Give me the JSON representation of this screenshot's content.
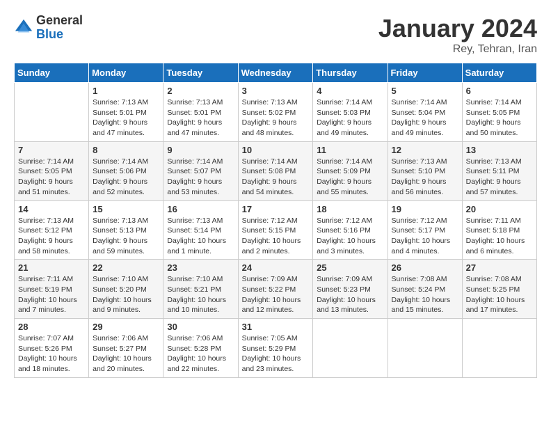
{
  "logo": {
    "general": "General",
    "blue": "Blue"
  },
  "title": "January 2024",
  "location": "Rey, Tehran, Iran",
  "days_of_week": [
    "Sunday",
    "Monday",
    "Tuesday",
    "Wednesday",
    "Thursday",
    "Friday",
    "Saturday"
  ],
  "weeks": [
    [
      {
        "day": "",
        "info": ""
      },
      {
        "day": "1",
        "info": "Sunrise: 7:13 AM\nSunset: 5:01 PM\nDaylight: 9 hours\nand 47 minutes."
      },
      {
        "day": "2",
        "info": "Sunrise: 7:13 AM\nSunset: 5:01 PM\nDaylight: 9 hours\nand 47 minutes."
      },
      {
        "day": "3",
        "info": "Sunrise: 7:13 AM\nSunset: 5:02 PM\nDaylight: 9 hours\nand 48 minutes."
      },
      {
        "day": "4",
        "info": "Sunrise: 7:14 AM\nSunset: 5:03 PM\nDaylight: 9 hours\nand 49 minutes."
      },
      {
        "day": "5",
        "info": "Sunrise: 7:14 AM\nSunset: 5:04 PM\nDaylight: 9 hours\nand 49 minutes."
      },
      {
        "day": "6",
        "info": "Sunrise: 7:14 AM\nSunset: 5:05 PM\nDaylight: 9 hours\nand 50 minutes."
      }
    ],
    [
      {
        "day": "7",
        "info": "Sunrise: 7:14 AM\nSunset: 5:05 PM\nDaylight: 9 hours\nand 51 minutes."
      },
      {
        "day": "8",
        "info": "Sunrise: 7:14 AM\nSunset: 5:06 PM\nDaylight: 9 hours\nand 52 minutes."
      },
      {
        "day": "9",
        "info": "Sunrise: 7:14 AM\nSunset: 5:07 PM\nDaylight: 9 hours\nand 53 minutes."
      },
      {
        "day": "10",
        "info": "Sunrise: 7:14 AM\nSunset: 5:08 PM\nDaylight: 9 hours\nand 54 minutes."
      },
      {
        "day": "11",
        "info": "Sunrise: 7:14 AM\nSunset: 5:09 PM\nDaylight: 9 hours\nand 55 minutes."
      },
      {
        "day": "12",
        "info": "Sunrise: 7:13 AM\nSunset: 5:10 PM\nDaylight: 9 hours\nand 56 minutes."
      },
      {
        "day": "13",
        "info": "Sunrise: 7:13 AM\nSunset: 5:11 PM\nDaylight: 9 hours\nand 57 minutes."
      }
    ],
    [
      {
        "day": "14",
        "info": "Sunrise: 7:13 AM\nSunset: 5:12 PM\nDaylight: 9 hours\nand 58 minutes."
      },
      {
        "day": "15",
        "info": "Sunrise: 7:13 AM\nSunset: 5:13 PM\nDaylight: 9 hours\nand 59 minutes."
      },
      {
        "day": "16",
        "info": "Sunrise: 7:13 AM\nSunset: 5:14 PM\nDaylight: 10 hours\nand 1 minute."
      },
      {
        "day": "17",
        "info": "Sunrise: 7:12 AM\nSunset: 5:15 PM\nDaylight: 10 hours\nand 2 minutes."
      },
      {
        "day": "18",
        "info": "Sunrise: 7:12 AM\nSunset: 5:16 PM\nDaylight: 10 hours\nand 3 minutes."
      },
      {
        "day": "19",
        "info": "Sunrise: 7:12 AM\nSunset: 5:17 PM\nDaylight: 10 hours\nand 4 minutes."
      },
      {
        "day": "20",
        "info": "Sunrise: 7:11 AM\nSunset: 5:18 PM\nDaylight: 10 hours\nand 6 minutes."
      }
    ],
    [
      {
        "day": "21",
        "info": "Sunrise: 7:11 AM\nSunset: 5:19 PM\nDaylight: 10 hours\nand 7 minutes."
      },
      {
        "day": "22",
        "info": "Sunrise: 7:10 AM\nSunset: 5:20 PM\nDaylight: 10 hours\nand 9 minutes."
      },
      {
        "day": "23",
        "info": "Sunrise: 7:10 AM\nSunset: 5:21 PM\nDaylight: 10 hours\nand 10 minutes."
      },
      {
        "day": "24",
        "info": "Sunrise: 7:09 AM\nSunset: 5:22 PM\nDaylight: 10 hours\nand 12 minutes."
      },
      {
        "day": "25",
        "info": "Sunrise: 7:09 AM\nSunset: 5:23 PM\nDaylight: 10 hours\nand 13 minutes."
      },
      {
        "day": "26",
        "info": "Sunrise: 7:08 AM\nSunset: 5:24 PM\nDaylight: 10 hours\nand 15 minutes."
      },
      {
        "day": "27",
        "info": "Sunrise: 7:08 AM\nSunset: 5:25 PM\nDaylight: 10 hours\nand 17 minutes."
      }
    ],
    [
      {
        "day": "28",
        "info": "Sunrise: 7:07 AM\nSunset: 5:26 PM\nDaylight: 10 hours\nand 18 minutes."
      },
      {
        "day": "29",
        "info": "Sunrise: 7:06 AM\nSunset: 5:27 PM\nDaylight: 10 hours\nand 20 minutes."
      },
      {
        "day": "30",
        "info": "Sunrise: 7:06 AM\nSunset: 5:28 PM\nDaylight: 10 hours\nand 22 minutes."
      },
      {
        "day": "31",
        "info": "Sunrise: 7:05 AM\nSunset: 5:29 PM\nDaylight: 10 hours\nand 23 minutes."
      },
      {
        "day": "",
        "info": ""
      },
      {
        "day": "",
        "info": ""
      },
      {
        "day": "",
        "info": ""
      }
    ]
  ]
}
